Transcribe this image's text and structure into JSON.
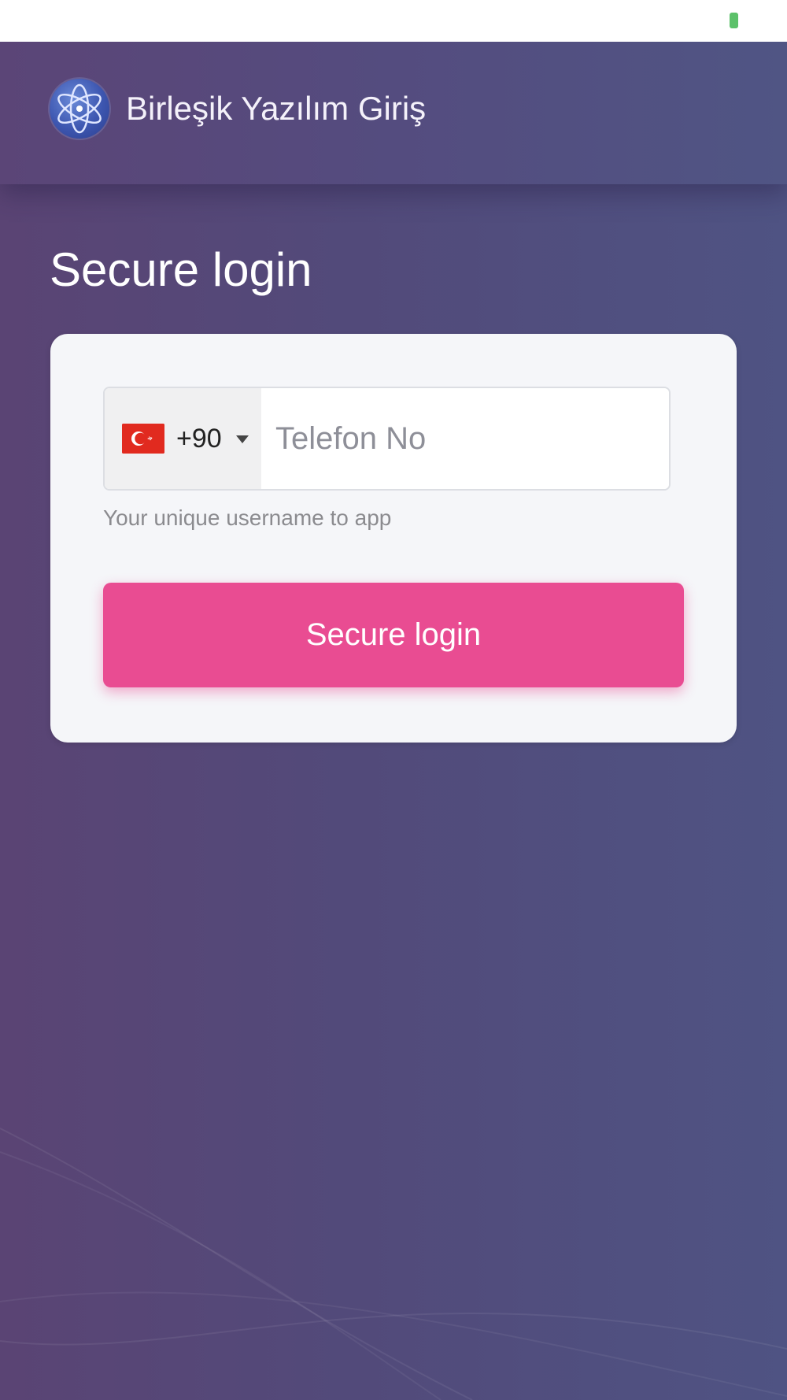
{
  "header": {
    "app_title": "Birleşik Yazılım Giriş",
    "logo_icon": "atom-icon"
  },
  "page": {
    "title": "Secure login"
  },
  "form": {
    "country": {
      "flag": "turkey-flag-icon",
      "dial_code": "+90"
    },
    "phone": {
      "placeholder": "Telefon No",
      "value": ""
    },
    "helper_text": "Your unique username to app",
    "submit_label": "Secure login"
  },
  "colors": {
    "primary": "#e94c92",
    "background_start": "#5a4474",
    "background_end": "#4f5383",
    "card": "#f5f6f9",
    "battery": "#5cc16a"
  }
}
